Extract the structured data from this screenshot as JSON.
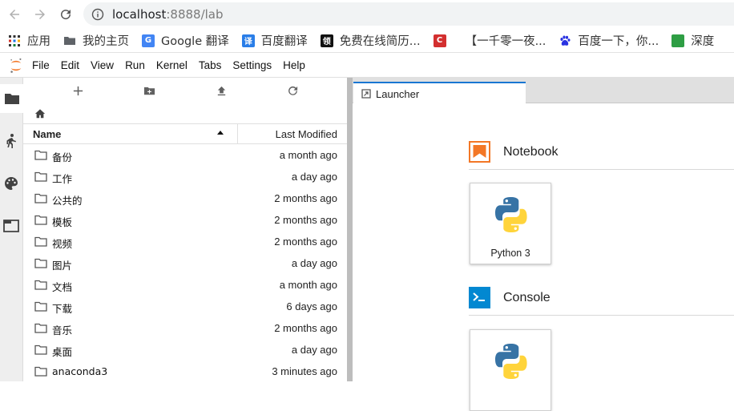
{
  "browser": {
    "url_host": "localhost",
    "url_rest": ":8888/lab",
    "bookmarks": [
      {
        "icon": "apps-grid-icon",
        "label": "应用"
      },
      {
        "icon": "folder-icon",
        "label": "我的主页"
      },
      {
        "icon": "google-translate-icon",
        "label": "Google 翻译"
      },
      {
        "icon": "baidu-translate-icon",
        "label": "百度翻译"
      },
      {
        "icon": "lingoes-icon",
        "label": "免费在线简历..."
      },
      {
        "icon": "red-c-icon",
        "label": ""
      },
      {
        "icon": "bookmark-page-icon",
        "label": "【一千零一夜..."
      },
      {
        "icon": "baidu-paw-icon",
        "label": "百度一下，你..."
      },
      {
        "icon": "green-leaf-icon",
        "label": "深度"
      }
    ]
  },
  "menu": [
    "File",
    "Edit",
    "View",
    "Run",
    "Kernel",
    "Tabs",
    "Settings",
    "Help"
  ],
  "filebrowser": {
    "header_name": "Name",
    "header_modified": "Last Modified",
    "files": [
      {
        "name": "备份",
        "modified": "a month ago"
      },
      {
        "name": "工作",
        "modified": "a day ago"
      },
      {
        "name": "公共的",
        "modified": "2 months ago"
      },
      {
        "name": "模板",
        "modified": "2 months ago"
      },
      {
        "name": "视频",
        "modified": "2 months ago"
      },
      {
        "name": "图片",
        "modified": "a day ago"
      },
      {
        "name": "文档",
        "modified": "a month ago"
      },
      {
        "name": "下载",
        "modified": "6 days ago"
      },
      {
        "name": "音乐",
        "modified": "2 months ago"
      },
      {
        "name": "桌面",
        "modified": "a day ago"
      },
      {
        "name": "anaconda3",
        "modified": "3 minutes ago"
      }
    ]
  },
  "main": {
    "tab_label": "Launcher",
    "sections": [
      {
        "title": "Notebook",
        "color": "#f37726",
        "cards": [
          {
            "label": "Python 3"
          }
        ]
      },
      {
        "title": "Console",
        "color": "#0288d1",
        "cards": [
          {
            "label": ""
          }
        ]
      }
    ]
  },
  "colors": {
    "accent": "#1976d2",
    "jupyter_orange": "#f37726"
  }
}
